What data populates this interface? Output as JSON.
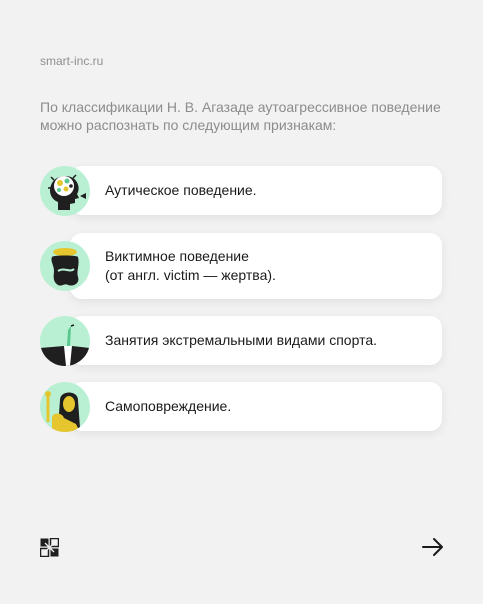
{
  "site": "smart-inc.ru",
  "intro": "По классификации Н. В. Агазаде аутоагрессивное поведение можно распознать по следующим признакам:",
  "items": [
    {
      "label": "Аутическое поведение.",
      "icon": "head-brain-icon"
    },
    {
      "label": "Виктимное поведение\n(от англ. victim — жертва).",
      "icon": "crouching-figure-icon"
    },
    {
      "label": "Занятия экстремальными видами спорта.",
      "icon": "extreme-sport-icon"
    },
    {
      "label": "Самоповреждение.",
      "icon": "self-harm-figure-icon"
    }
  ],
  "colors": {
    "accent": "#b9f0d3",
    "intro_text": "#8c8c8c",
    "card": "#ffffff",
    "background": "#f2f2f2"
  },
  "footer": {
    "logo_icon": "smart-logo-icon",
    "next_icon": "arrow-right-icon"
  }
}
